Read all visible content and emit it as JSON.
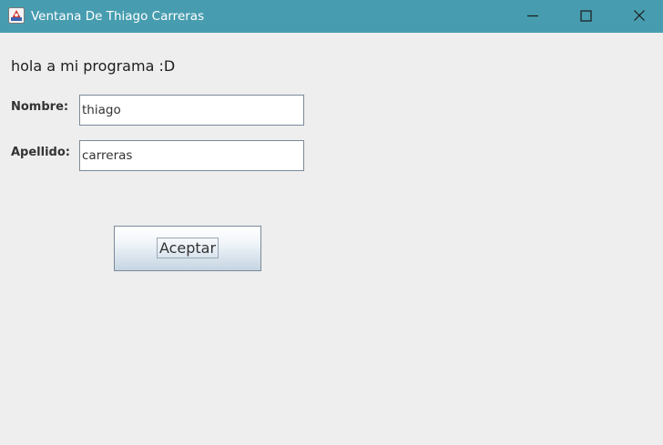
{
  "window": {
    "title": "Ventana De Thiago Carreras",
    "titlebar_color": "#479daf",
    "icon": "java-app-icon",
    "controls": [
      "minimize-icon",
      "maximize-icon",
      "close-icon"
    ]
  },
  "main": {
    "greeting": "hola a mi programa :D",
    "form": {
      "nombre_label": "Nombre:",
      "nombre_value": "thiago",
      "apellido_label": "Apellido:",
      "apellido_value": "carreras",
      "accept_label": "Aceptar"
    }
  }
}
